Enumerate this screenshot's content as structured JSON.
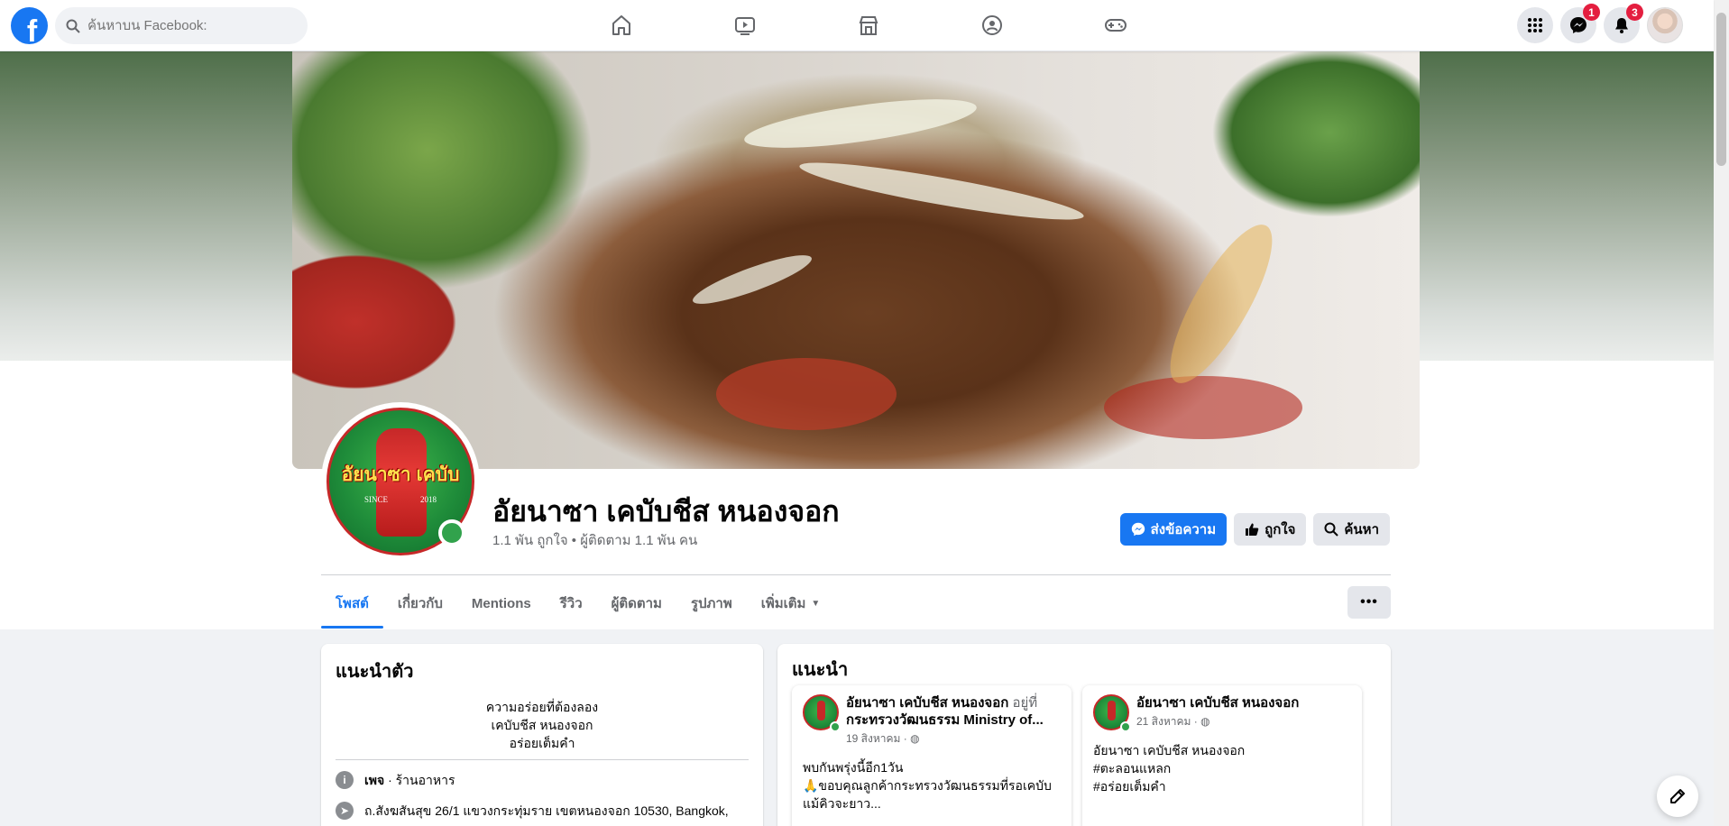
{
  "topbar": {
    "search_placeholder": "ค้นหาบน Facebook:",
    "logo_letter": "f",
    "nav": [
      "home-icon",
      "watch-icon",
      "marketplace-icon",
      "groups-icon",
      "gaming-icon"
    ],
    "messenger_badge": "1",
    "notifications_badge": "3"
  },
  "page": {
    "name": "อัยนาซา เคบับชีส หนองจอก",
    "stats": "1.1 พัน ถูกใจ • ผู้ติดตาม 1.1 พัน คน",
    "logo_text": "อัยนาซา เคบับ",
    "logo_since": "SINCE",
    "logo_year": "2018"
  },
  "actions": {
    "message": "ส่งข้อความ",
    "like": "ถูกใจ",
    "search": "ค้นหา"
  },
  "tabs": [
    {
      "label": "โพสต์",
      "active": true
    },
    {
      "label": "เกี่ยวกับ"
    },
    {
      "label": "Mentions"
    },
    {
      "label": "รีวิว"
    },
    {
      "label": "ผู้ติดตาม"
    },
    {
      "label": "รูปภาพ"
    },
    {
      "label": "เพิ่มเติม"
    }
  ],
  "more_menu": "•••",
  "intro": {
    "title": "แนะนำตัว",
    "bio": [
      "ความอร่อยที่ต้องลอง",
      "เคบับชีส หนองจอก",
      "อร่อยเต็มคำ"
    ],
    "category_label": "เพจ",
    "category_value": " · ร้านอาหาร",
    "address": "ถ.สังฆสันสุข 26/1 แขวงกระทุ่มราย เขตหนองจอก 10530, Bangkok,"
  },
  "featured": {
    "title": "แนะนำ",
    "posts": [
      {
        "name": "อัยนาซา เคบับชีส หนองจอก",
        "at": " อยู่ที่",
        "place": "กระทรวงวัฒนธรรม Ministry of...",
        "date": "19 สิงหาคม ·",
        "body": [
          "พบกันพรุ่งนี้อีก1วัน",
          "🙏ขอบคุณลูกค้ากระทรวงวัฒนธรรมที่รอเคบับ",
          "แม้คิวจะยาว..."
        ]
      },
      {
        "name": "อัยนาซา เคบับชีส หนองจอก",
        "date": "21 สิงหาคม ·",
        "body": [
          "อัยนาซา เคบับชีส หนองจอก",
          "#ตะลอนแหลก",
          "#อร่อยเต็มคำ"
        ]
      }
    ]
  },
  "colors": {
    "brand": "#1877f2",
    "badge": "#e41e3f",
    "online": "#31a24c"
  }
}
